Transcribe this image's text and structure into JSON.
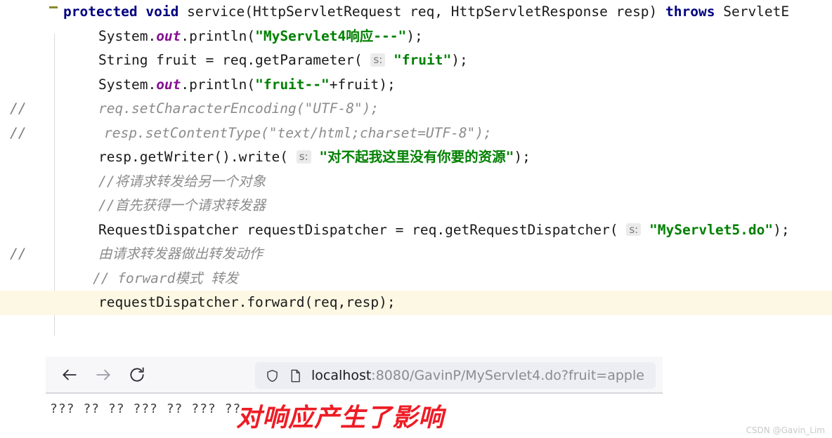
{
  "editor": {
    "fold_marker": "collapsed-region-dash",
    "lines": [
      {
        "id": "line-signature",
        "marker": "",
        "highlighted": false,
        "indent": 0,
        "tokens": [
          {
            "t": "kw",
            "v": "protected void "
          },
          {
            "t": "plain",
            "v": "service(HttpServletRequest req, HttpServletResponse resp) "
          },
          {
            "t": "kw",
            "v": "throws "
          },
          {
            "t": "plain",
            "v": "ServletE"
          }
        ]
      },
      {
        "id": "line-println-myservlet4",
        "marker": "",
        "highlighted": false,
        "indent": 50,
        "tokens": [
          {
            "t": "plain",
            "v": "System."
          },
          {
            "t": "fld",
            "v": "out"
          },
          {
            "t": "plain",
            "v": ".println("
          },
          {
            "t": "str",
            "v": "\"MyServlet4响应---\""
          },
          {
            "t": "plain",
            "v": ");"
          }
        ]
      },
      {
        "id": "line-get-parameter",
        "marker": "",
        "highlighted": false,
        "indent": 50,
        "tokens": [
          {
            "t": "plain",
            "v": "String fruit = req.getParameter( "
          },
          {
            "t": "hint",
            "v": "s:"
          },
          {
            "t": "plain",
            "v": " "
          },
          {
            "t": "str",
            "v": "\"fruit\""
          },
          {
            "t": "plain",
            "v": ");"
          }
        ]
      },
      {
        "id": "line-println-fruit",
        "marker": "",
        "highlighted": false,
        "indent": 50,
        "tokens": [
          {
            "t": "plain",
            "v": "System."
          },
          {
            "t": "fld",
            "v": "out"
          },
          {
            "t": "plain",
            "v": ".println("
          },
          {
            "t": "str",
            "v": "\"fruit--\""
          },
          {
            "t": "plain",
            "v": "+fruit);"
          }
        ]
      },
      {
        "id": "line-set-character-encoding",
        "marker": "//",
        "highlighted": false,
        "indent": 50,
        "tokens": [
          {
            "t": "comment",
            "v": "req.setCharacterEncoding(\"UTF-8\");"
          }
        ]
      },
      {
        "id": "line-set-content-type",
        "marker": "//",
        "highlighted": false,
        "indent": 58,
        "tokens": [
          {
            "t": "comment",
            "v": "resp.setContentType(\"text/html;charset=UTF-8\");"
          }
        ]
      },
      {
        "id": "line-get-writer-write",
        "marker": "",
        "highlighted": false,
        "indent": 50,
        "tokens": [
          {
            "t": "plain",
            "v": "resp.getWriter().write( "
          },
          {
            "t": "hint",
            "v": "s:"
          },
          {
            "t": "plain",
            "v": " "
          },
          {
            "t": "str",
            "v": "\"对不起我这里没有你要的资源\""
          },
          {
            "t": "plain",
            "v": ");"
          }
        ]
      },
      {
        "id": "line-comment-forward-to-other",
        "marker": "",
        "highlighted": false,
        "indent": 50,
        "tokens": [
          {
            "t": "comment",
            "v": "//将请求转发给另一个对象"
          }
        ]
      },
      {
        "id": "line-comment-get-dispatcher",
        "marker": "",
        "highlighted": false,
        "indent": 50,
        "tokens": [
          {
            "t": "comment",
            "v": "//首先获得一个请求转发器"
          }
        ]
      },
      {
        "id": "line-request-dispatcher",
        "marker": "",
        "highlighted": false,
        "indent": 50,
        "tokens": [
          {
            "t": "plain",
            "v": "RequestDispatcher requestDispatcher = req.getRequestDispatcher( "
          },
          {
            "t": "hint",
            "v": "s:"
          },
          {
            "t": "plain",
            "v": " "
          },
          {
            "t": "str",
            "v": "\"MyServlet5.do\""
          },
          {
            "t": "plain",
            "v": ");"
          }
        ]
      },
      {
        "id": "line-comment-dispatcher-action",
        "marker": "//",
        "highlighted": false,
        "indent": 50,
        "tokens": [
          {
            "t": "comment",
            "v": "由请求转发器做出转发动作"
          }
        ]
      },
      {
        "id": "line-comment-forward-mode",
        "marker": "",
        "highlighted": false,
        "indent": 42,
        "tokens": [
          {
            "t": "comment",
            "v": "// forward模式 转发"
          }
        ]
      },
      {
        "id": "line-forward-call",
        "marker": "",
        "highlighted": true,
        "indent": 50,
        "tokens": [
          {
            "t": "plain",
            "v": "requestDispatcher.forward(req,resp);"
          }
        ]
      }
    ]
  },
  "browser": {
    "back_label": "Back",
    "forward_label": "Forward",
    "reload_label": "Reload",
    "shield_icon": "shield-icon",
    "page_icon": "page-document-icon",
    "url_host": "localhost",
    "url_rest": ":8080/GavinP/MyServlet4.do?fruit=apple",
    "url_full": "localhost:8080/GavinP/MyServlet4.do?fruit=apple"
  },
  "page": {
    "output_text": "??? ?? ?? ??? ?? ??? ??",
    "annotation_text": "对响应产生了影响",
    "annotation_color": "#ee1c25"
  },
  "watermark": {
    "text": "CSDN @Gavin_Lim"
  }
}
